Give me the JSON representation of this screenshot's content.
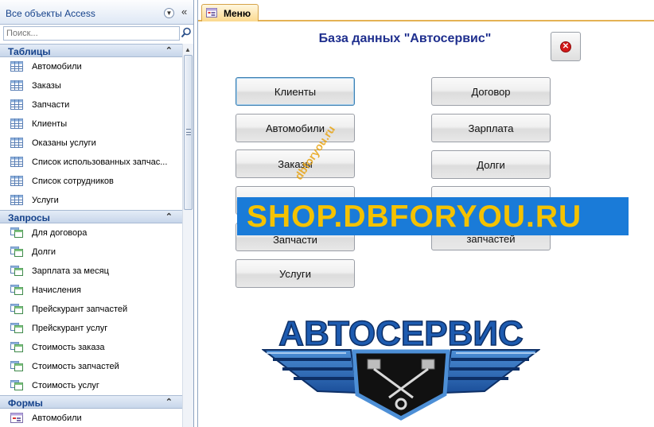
{
  "nav": {
    "title": "Все объекты Access",
    "search_placeholder": "Поиск...",
    "groups": [
      {
        "title": "Таблицы",
        "items": [
          "Автомобили",
          "Заказы",
          "Запчасти",
          "Клиенты",
          "Оказаны услуги",
          "Список использованных запчас...",
          "Список сотрудников",
          "Услуги"
        ]
      },
      {
        "title": "Запросы",
        "items": [
          "Для договора",
          "Долги",
          "Зарплата за месяц",
          "Начисления",
          "Прейскурант запчастей",
          "Прейскурант услуг",
          "Стоимость заказа",
          "Стоимость запчастей",
          "Стоимость услуг"
        ]
      },
      {
        "title": "Формы",
        "items": [
          "Автомобили"
        ]
      }
    ]
  },
  "tab": {
    "label": "Меню"
  },
  "form": {
    "title": "База данных \"Автосервис\"",
    "buttons": {
      "clients": "Клиенты",
      "cars": "Автомобили",
      "orders": "Заказы",
      "parts": "Запчасти",
      "services": "Услуги",
      "contract": "Договор",
      "salary": "Зарплата",
      "debts": "Долги",
      "parts_price": "запчастей"
    }
  },
  "watermark": {
    "band_text": "SHOP.DBFORYOU.RU",
    "diagonal_text": "dbforyou.ru"
  },
  "logo": {
    "text": "АВТОСЕРВИС"
  },
  "colors": {
    "title": "#1f2f8e",
    "nav_header_text": "#15428b",
    "watermark_band": "#1a7bd8",
    "watermark_text": "#f4c200",
    "tab_accent": "#e4b254",
    "close_icon": "#d31a1a"
  }
}
